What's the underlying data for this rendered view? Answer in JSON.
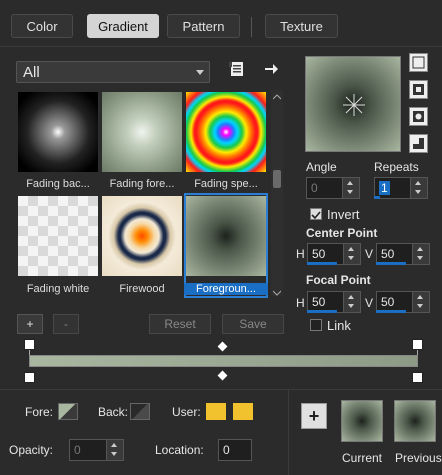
{
  "tabs": [
    {
      "label": "Color"
    },
    {
      "label": "Gradient",
      "active": true
    },
    {
      "label": "Pattern"
    },
    {
      "label": "Texture"
    }
  ],
  "category": {
    "value": "All"
  },
  "gradients": [
    {
      "label": "Fading bac..."
    },
    {
      "label": "Fading fore..."
    },
    {
      "label": "Fading spe..."
    },
    {
      "label": "Fading white"
    },
    {
      "label": "Firewood"
    },
    {
      "label": "Foregroun...",
      "selected": true
    }
  ],
  "angle": {
    "label": "Angle",
    "value": "0"
  },
  "repeats": {
    "label": "Repeats",
    "value": "1"
  },
  "invert": {
    "label": "Invert",
    "checked": true
  },
  "center_point": {
    "label": "Center Point",
    "h_label": "H",
    "h_value": "50",
    "v_label": "V",
    "v_value": "50"
  },
  "focal_point": {
    "label": "Focal Point",
    "h_label": "H",
    "h_value": "50",
    "v_label": "V",
    "v_value": "50"
  },
  "link": {
    "label": "Link",
    "checked": false
  },
  "editor_buttons": {
    "add": "+",
    "remove": "-",
    "reset": "Reset",
    "save": "Save"
  },
  "bottom": {
    "fore_label": "Fore:",
    "back_label": "Back:",
    "user_label": "User:",
    "opacity_label": "Opacity:",
    "opacity_value": "0",
    "location_label": "Location:",
    "location_value": "0",
    "add_button": "+",
    "current_label": "Current",
    "previous_label": "Previous"
  },
  "colors": {
    "gradient_light": "#a9b6a0",
    "gradient_dark": "#2f3a2f",
    "user_swatch": "#f2c12e",
    "accent": "#1a6fc4"
  }
}
